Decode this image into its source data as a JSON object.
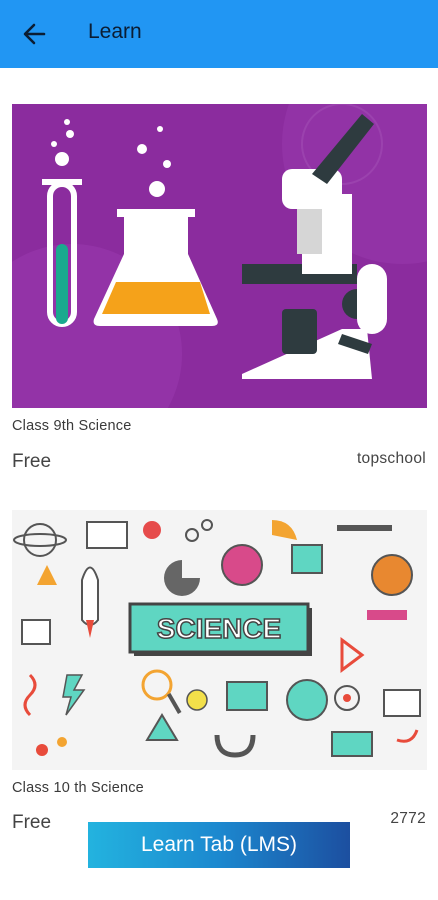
{
  "appbar": {
    "title": "Learn",
    "back_icon": "arrow-left-icon"
  },
  "courses": [
    {
      "title": "Class 9th Science",
      "price": "Free",
      "provider": "topschool",
      "image_desc": "laboratory-equipment-illustration"
    },
    {
      "title": "Class 10 th Science",
      "price": "Free",
      "provider": "2772",
      "image_desc": "science-doodle-illustration",
      "image_text": "SCIENCE"
    }
  ],
  "lms_button": {
    "label": "Learn Tab (LMS)"
  },
  "colors": {
    "appbar": "#2196f3",
    "image1_bg": "#8b2c9e",
    "button_start": "#23b3df",
    "button_end": "#1c4fa0"
  }
}
